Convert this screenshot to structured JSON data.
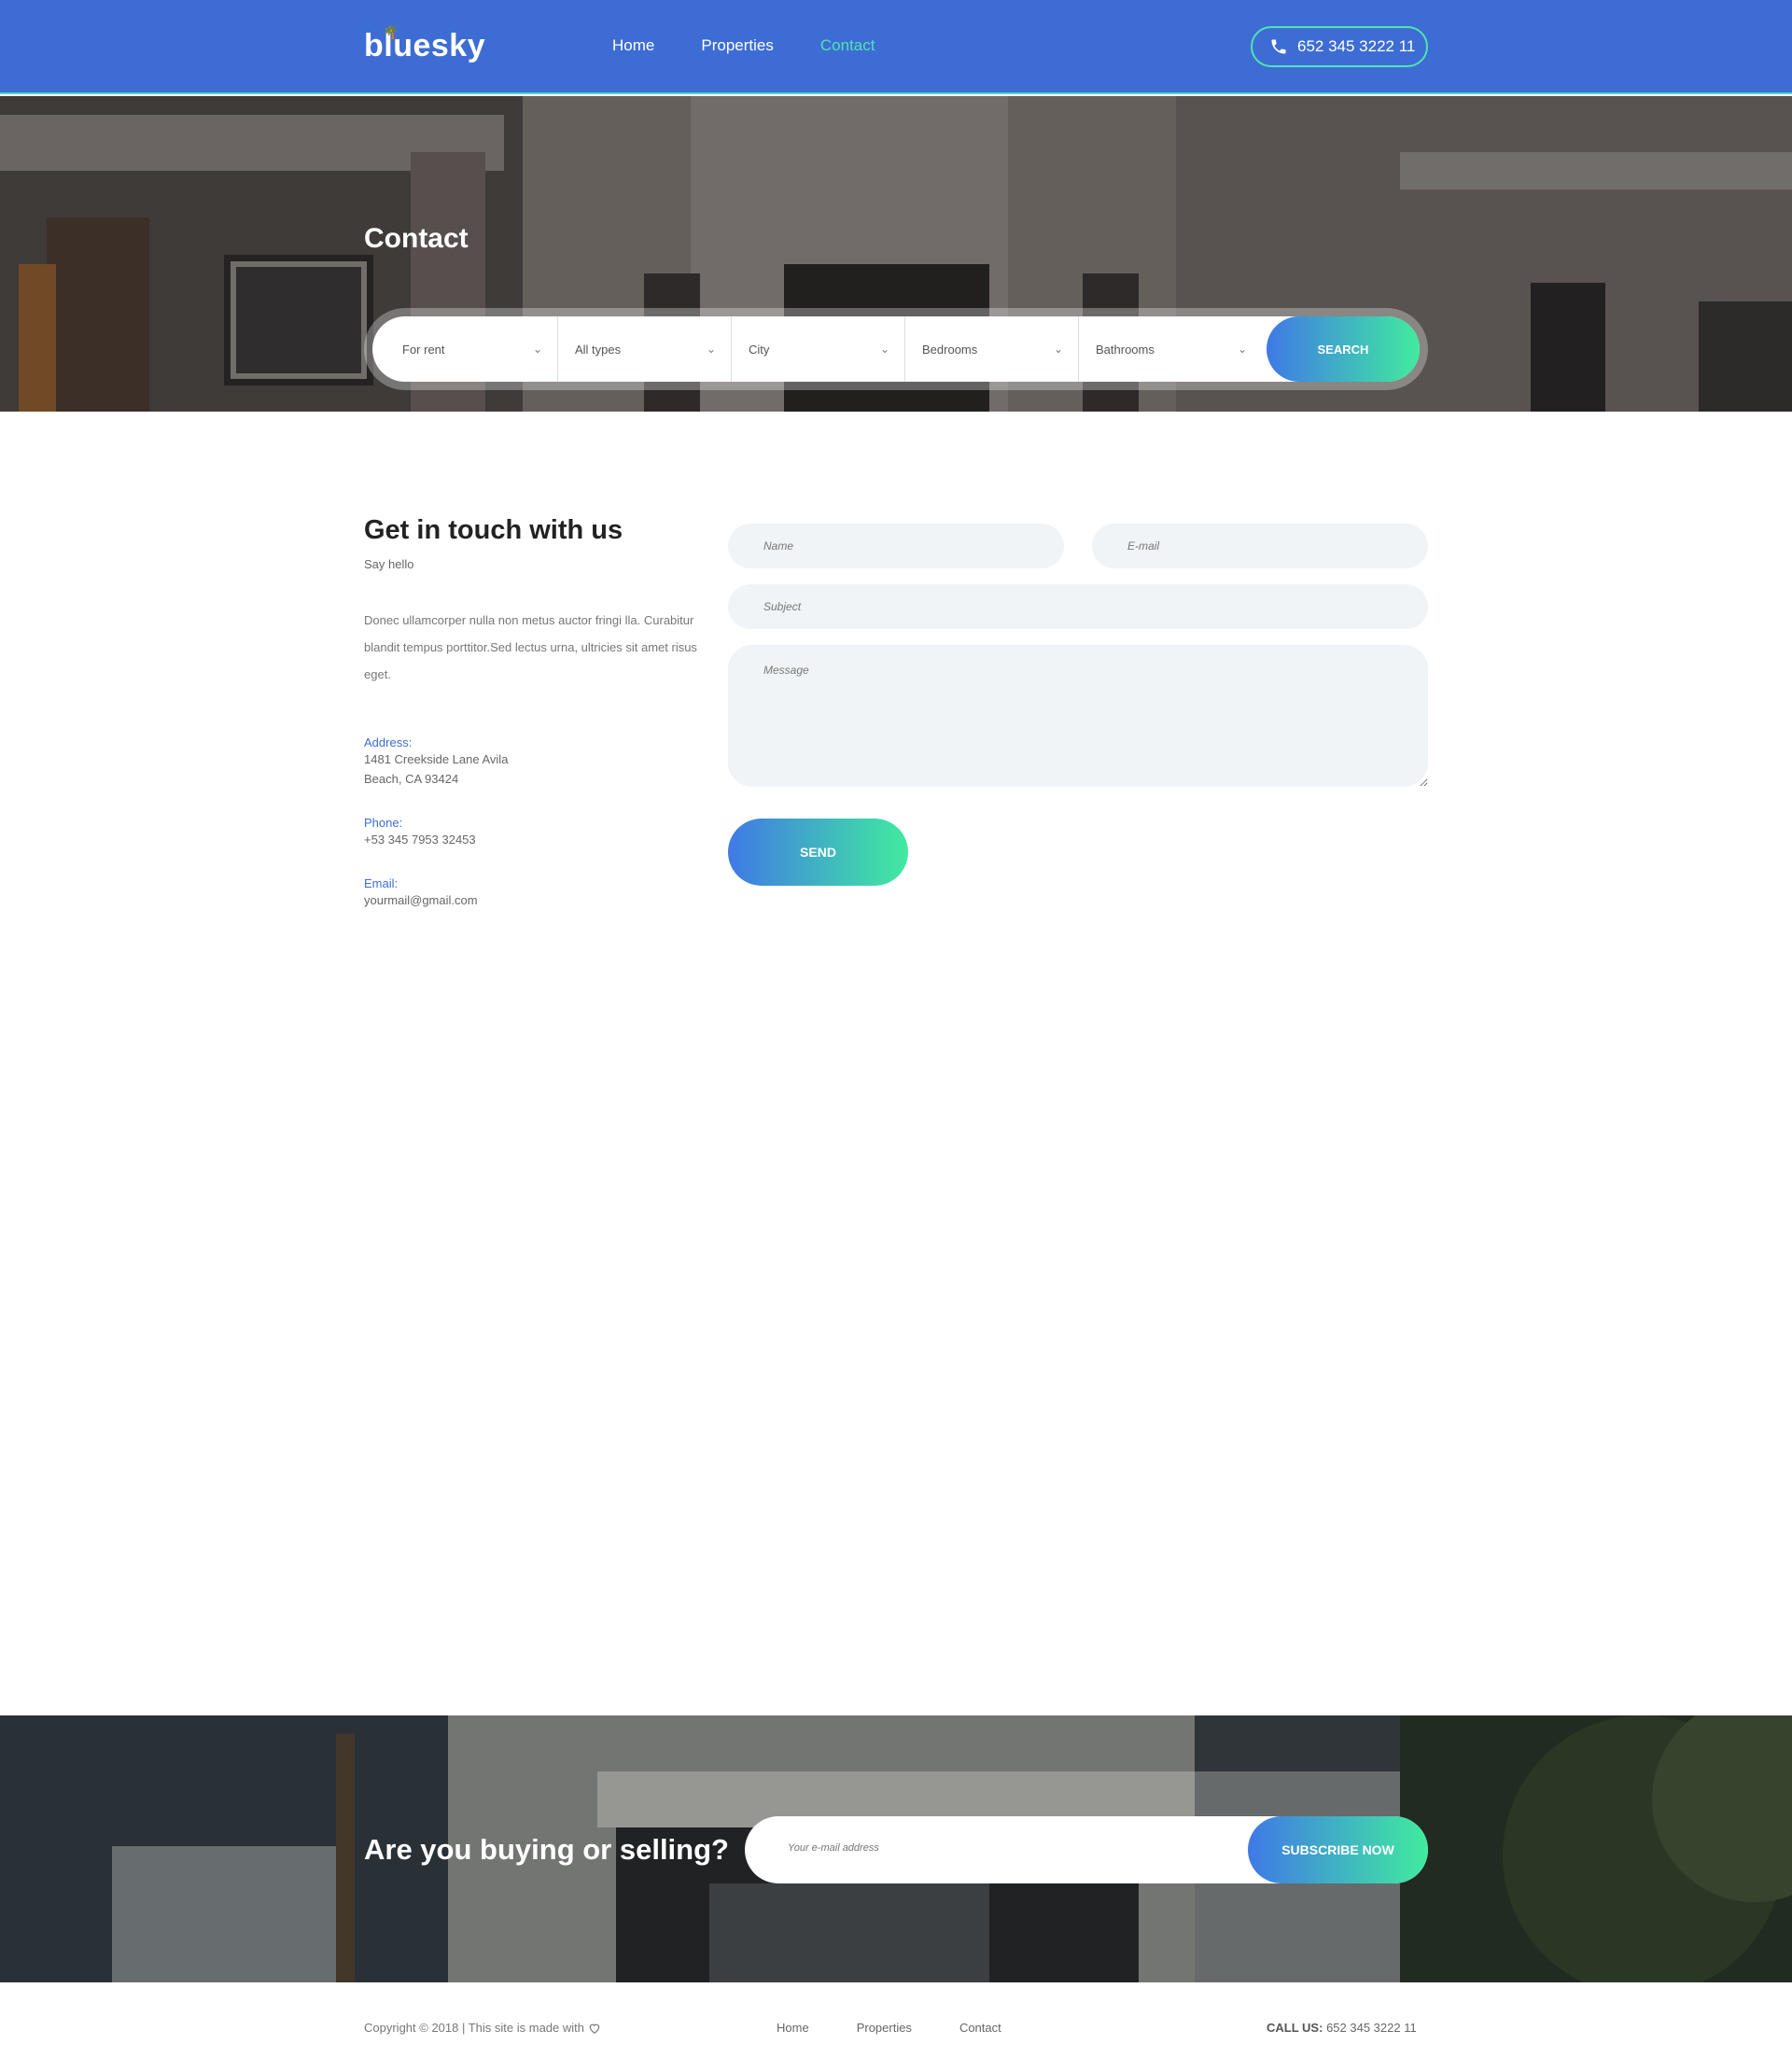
{
  "header": {
    "logo": "bluesky",
    "nav": [
      "Home",
      "Properties",
      "Contact"
    ],
    "active_nav": "Contact",
    "phone": "652 345 3222 11"
  },
  "hero": {
    "title": "Contact",
    "filters": [
      "For rent",
      "All types",
      "City",
      "Bedrooms",
      "Bathrooms"
    ],
    "search_label": "SEARCH"
  },
  "contact": {
    "heading": "Get in touch with us",
    "subheading": "Say hello",
    "description": "Donec ullamcorper nulla non metus auctor fringi lla. Curabitur blandit tempus porttitor.Sed lectus urna, ultricies sit amet risus eget.",
    "address_label": "Address:",
    "address_line1": "1481 Creekside Lane Avila",
    "address_line2": "Beach, CA 93424",
    "phone_label": "Phone:",
    "phone_value": "+53 345 7953 32453",
    "email_label": "Email:",
    "email_value": "yourmail@gmail.com"
  },
  "form": {
    "name_placeholder": "Name",
    "email_placeholder": "E-mail",
    "subject_placeholder": "Subject",
    "message_placeholder": "Message",
    "send_label": "SEND"
  },
  "subscribe": {
    "title": "Are you buying or selling?",
    "placeholder": "Your e-mail address",
    "button": "SUBSCRIBE NOW"
  },
  "footer": {
    "copyright": "Copyright © 2018 | This site is made with",
    "links": [
      "Home",
      "Properties",
      "Contact"
    ],
    "call_label": "CALL US:",
    "call_value": "652 345 3222 11"
  },
  "colors": {
    "header_bg": "#3d6dd4",
    "accent": "#4fe3b0",
    "gradient_start": "#3f79e6",
    "gradient_end": "#41eb9f"
  }
}
